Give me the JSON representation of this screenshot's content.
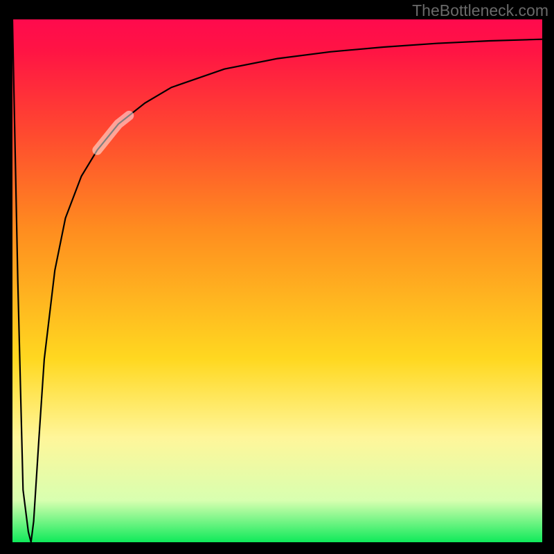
{
  "watermark": "TheBottleneck.com",
  "colors": {
    "gradient_top": "#ff0a4d",
    "gradient_mid": "#ffd820",
    "gradient_bottom": "#0fea5a",
    "highlight": "rgba(255,255,255,0.50)",
    "curve": "#000000",
    "frame_bg": "#000000",
    "watermark": "#6a6a6a"
  },
  "chart_data": {
    "type": "line",
    "title": "",
    "xlabel": "",
    "ylabel": "",
    "xlim": [
      0,
      100
    ],
    "ylim": [
      0,
      100
    ],
    "grid": false,
    "legend": false,
    "x": [
      0,
      1,
      2,
      3,
      3.5,
      4,
      5,
      6,
      8,
      10,
      13,
      16,
      20,
      25,
      30,
      40,
      50,
      60,
      70,
      80,
      90,
      100
    ],
    "values": [
      100,
      50,
      10,
      2,
      0,
      4,
      20,
      35,
      52,
      62,
      70,
      75,
      80,
      84,
      87,
      90.5,
      92.5,
      93.8,
      94.7,
      95.4,
      95.9,
      96.2
    ],
    "highlight_segment": {
      "x_start": 16,
      "x_end": 22
    },
    "notes": "y-axis 0=bottom(green) 100=top(red); curve dips to ~0 near x≈3.5 then asymptotically approaches ~96."
  }
}
